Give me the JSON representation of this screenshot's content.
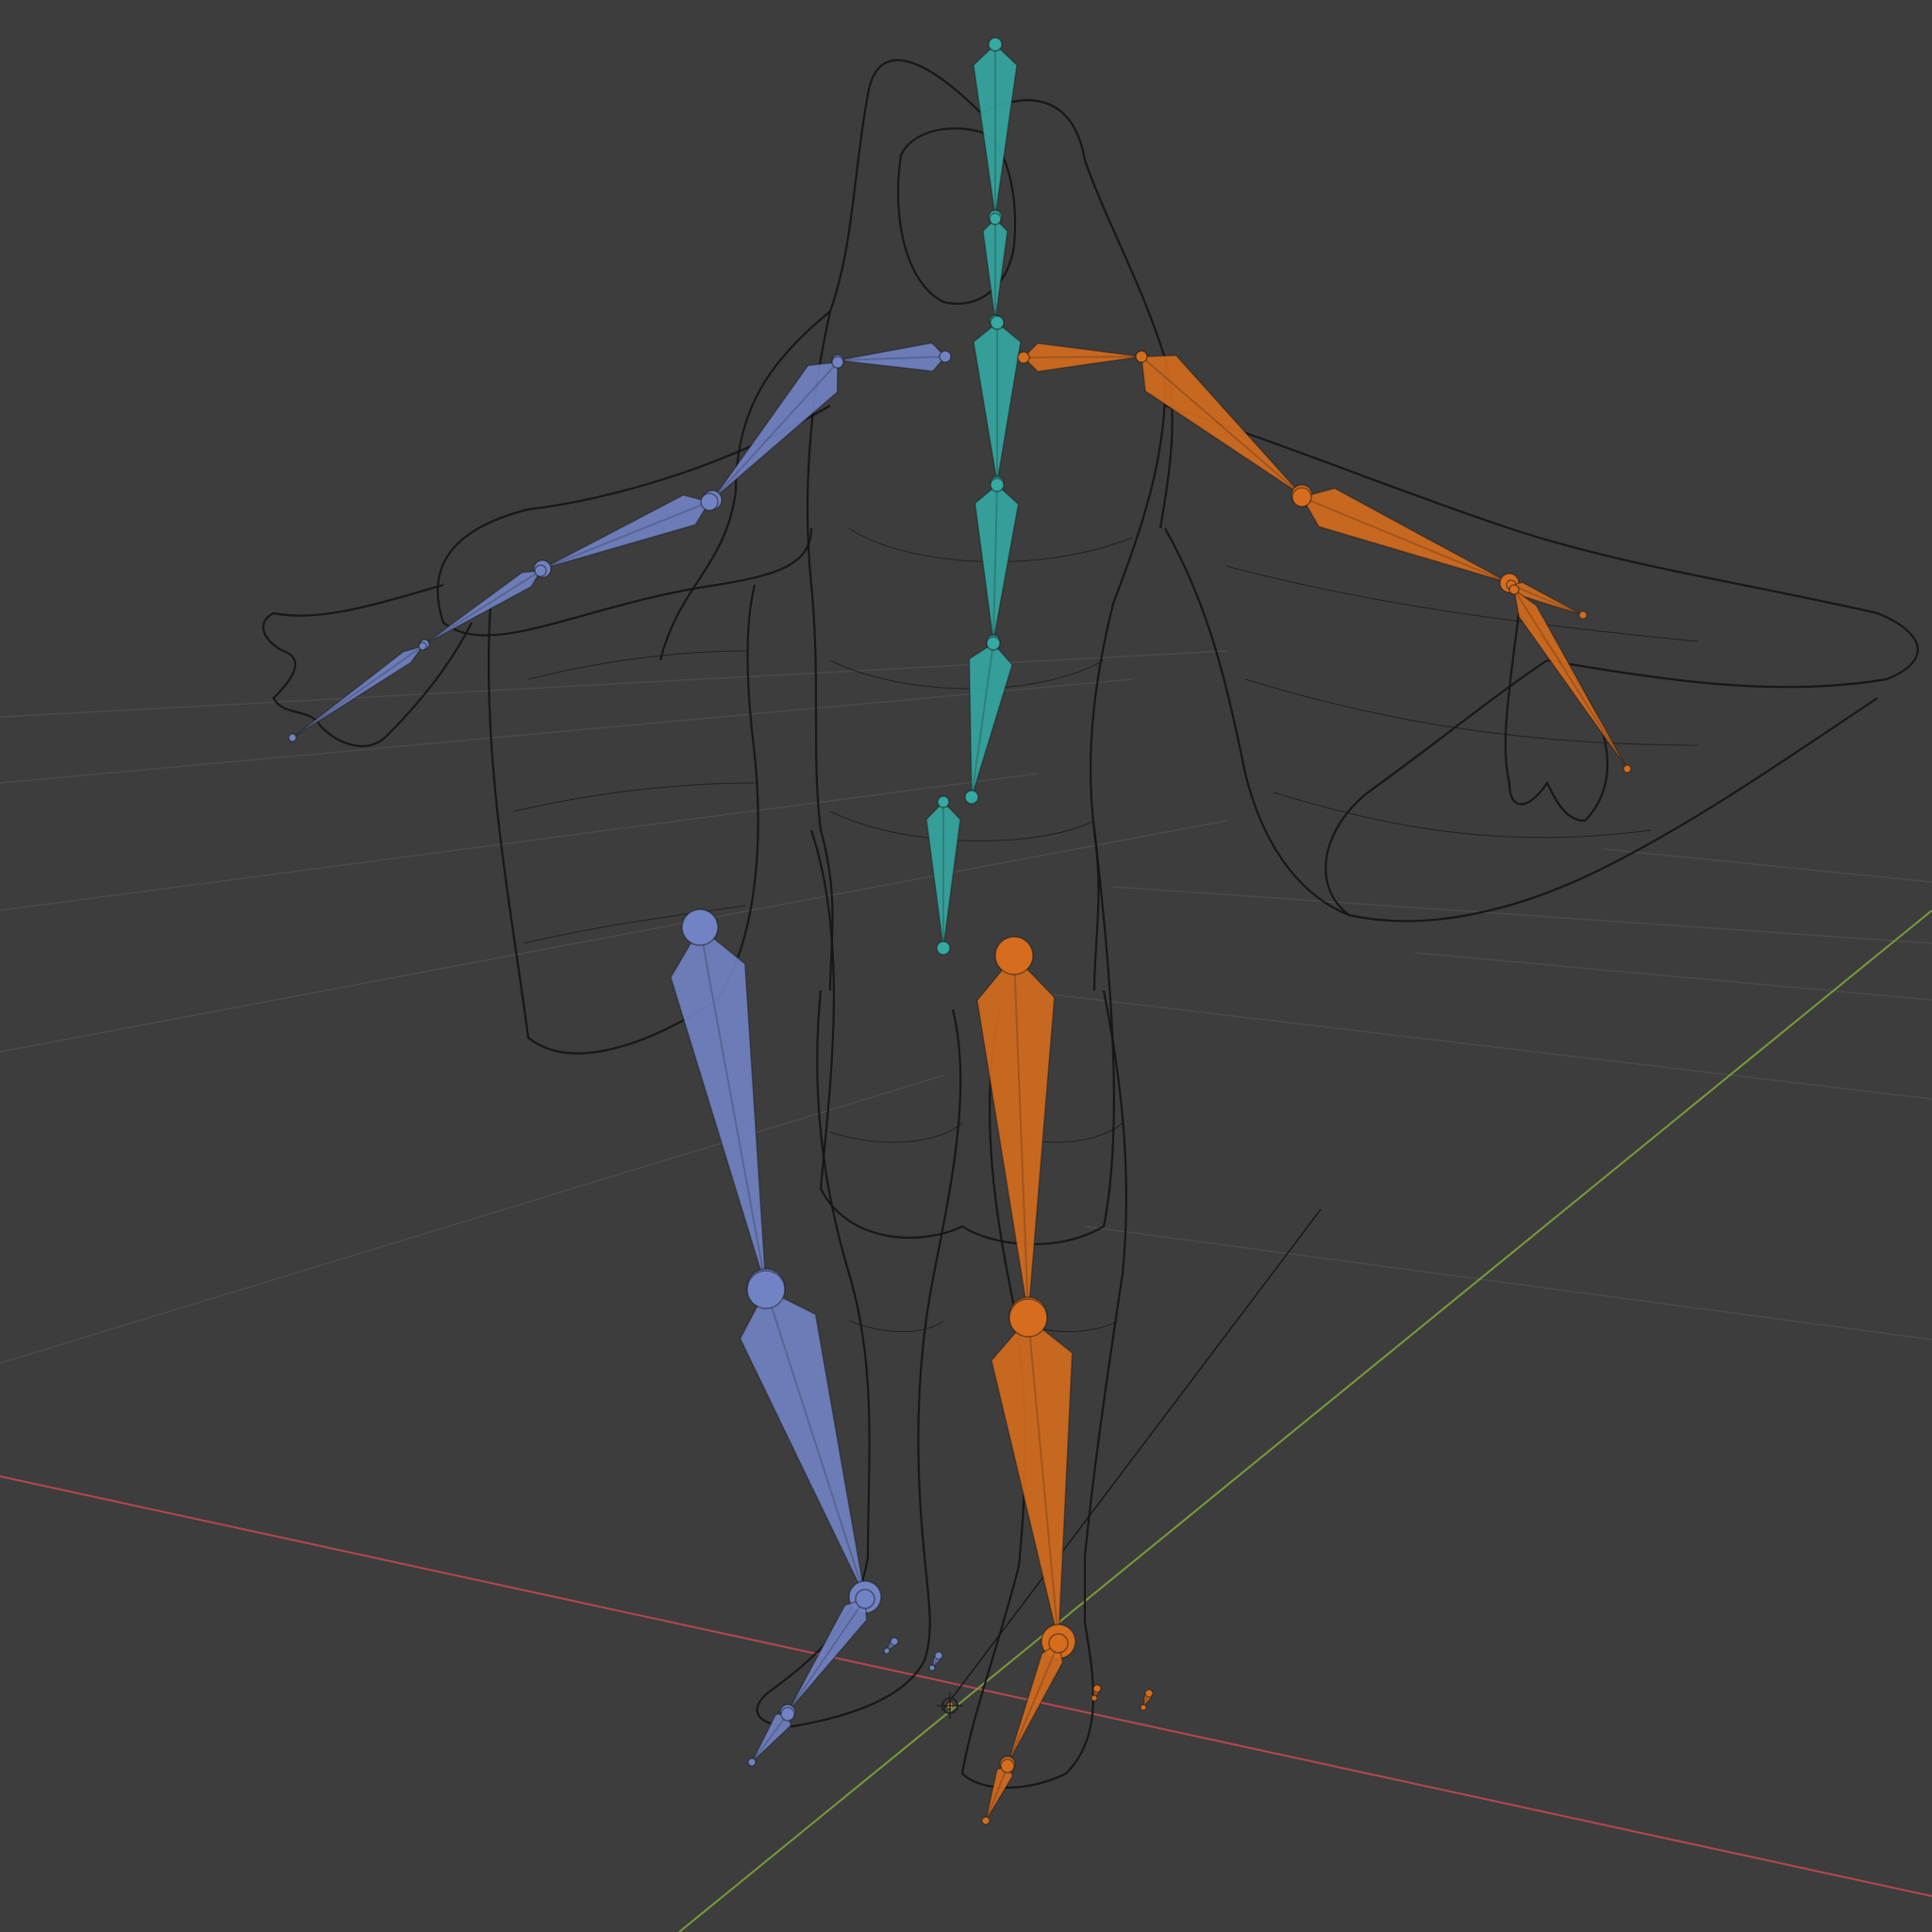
{
  "viewport": {
    "kind": "3d-viewport",
    "background": "#3d3d3d",
    "grid_color": "#4a4a4a",
    "x_axis_color": "#b3474f",
    "y_axis_color": "#7a9a3a"
  },
  "rig": {
    "center_bone_color": "#35a9a2",
    "left_bone_color": "#7183c4",
    "right_bone_color": "#d66d1e",
    "mesh_color": "#141414"
  }
}
